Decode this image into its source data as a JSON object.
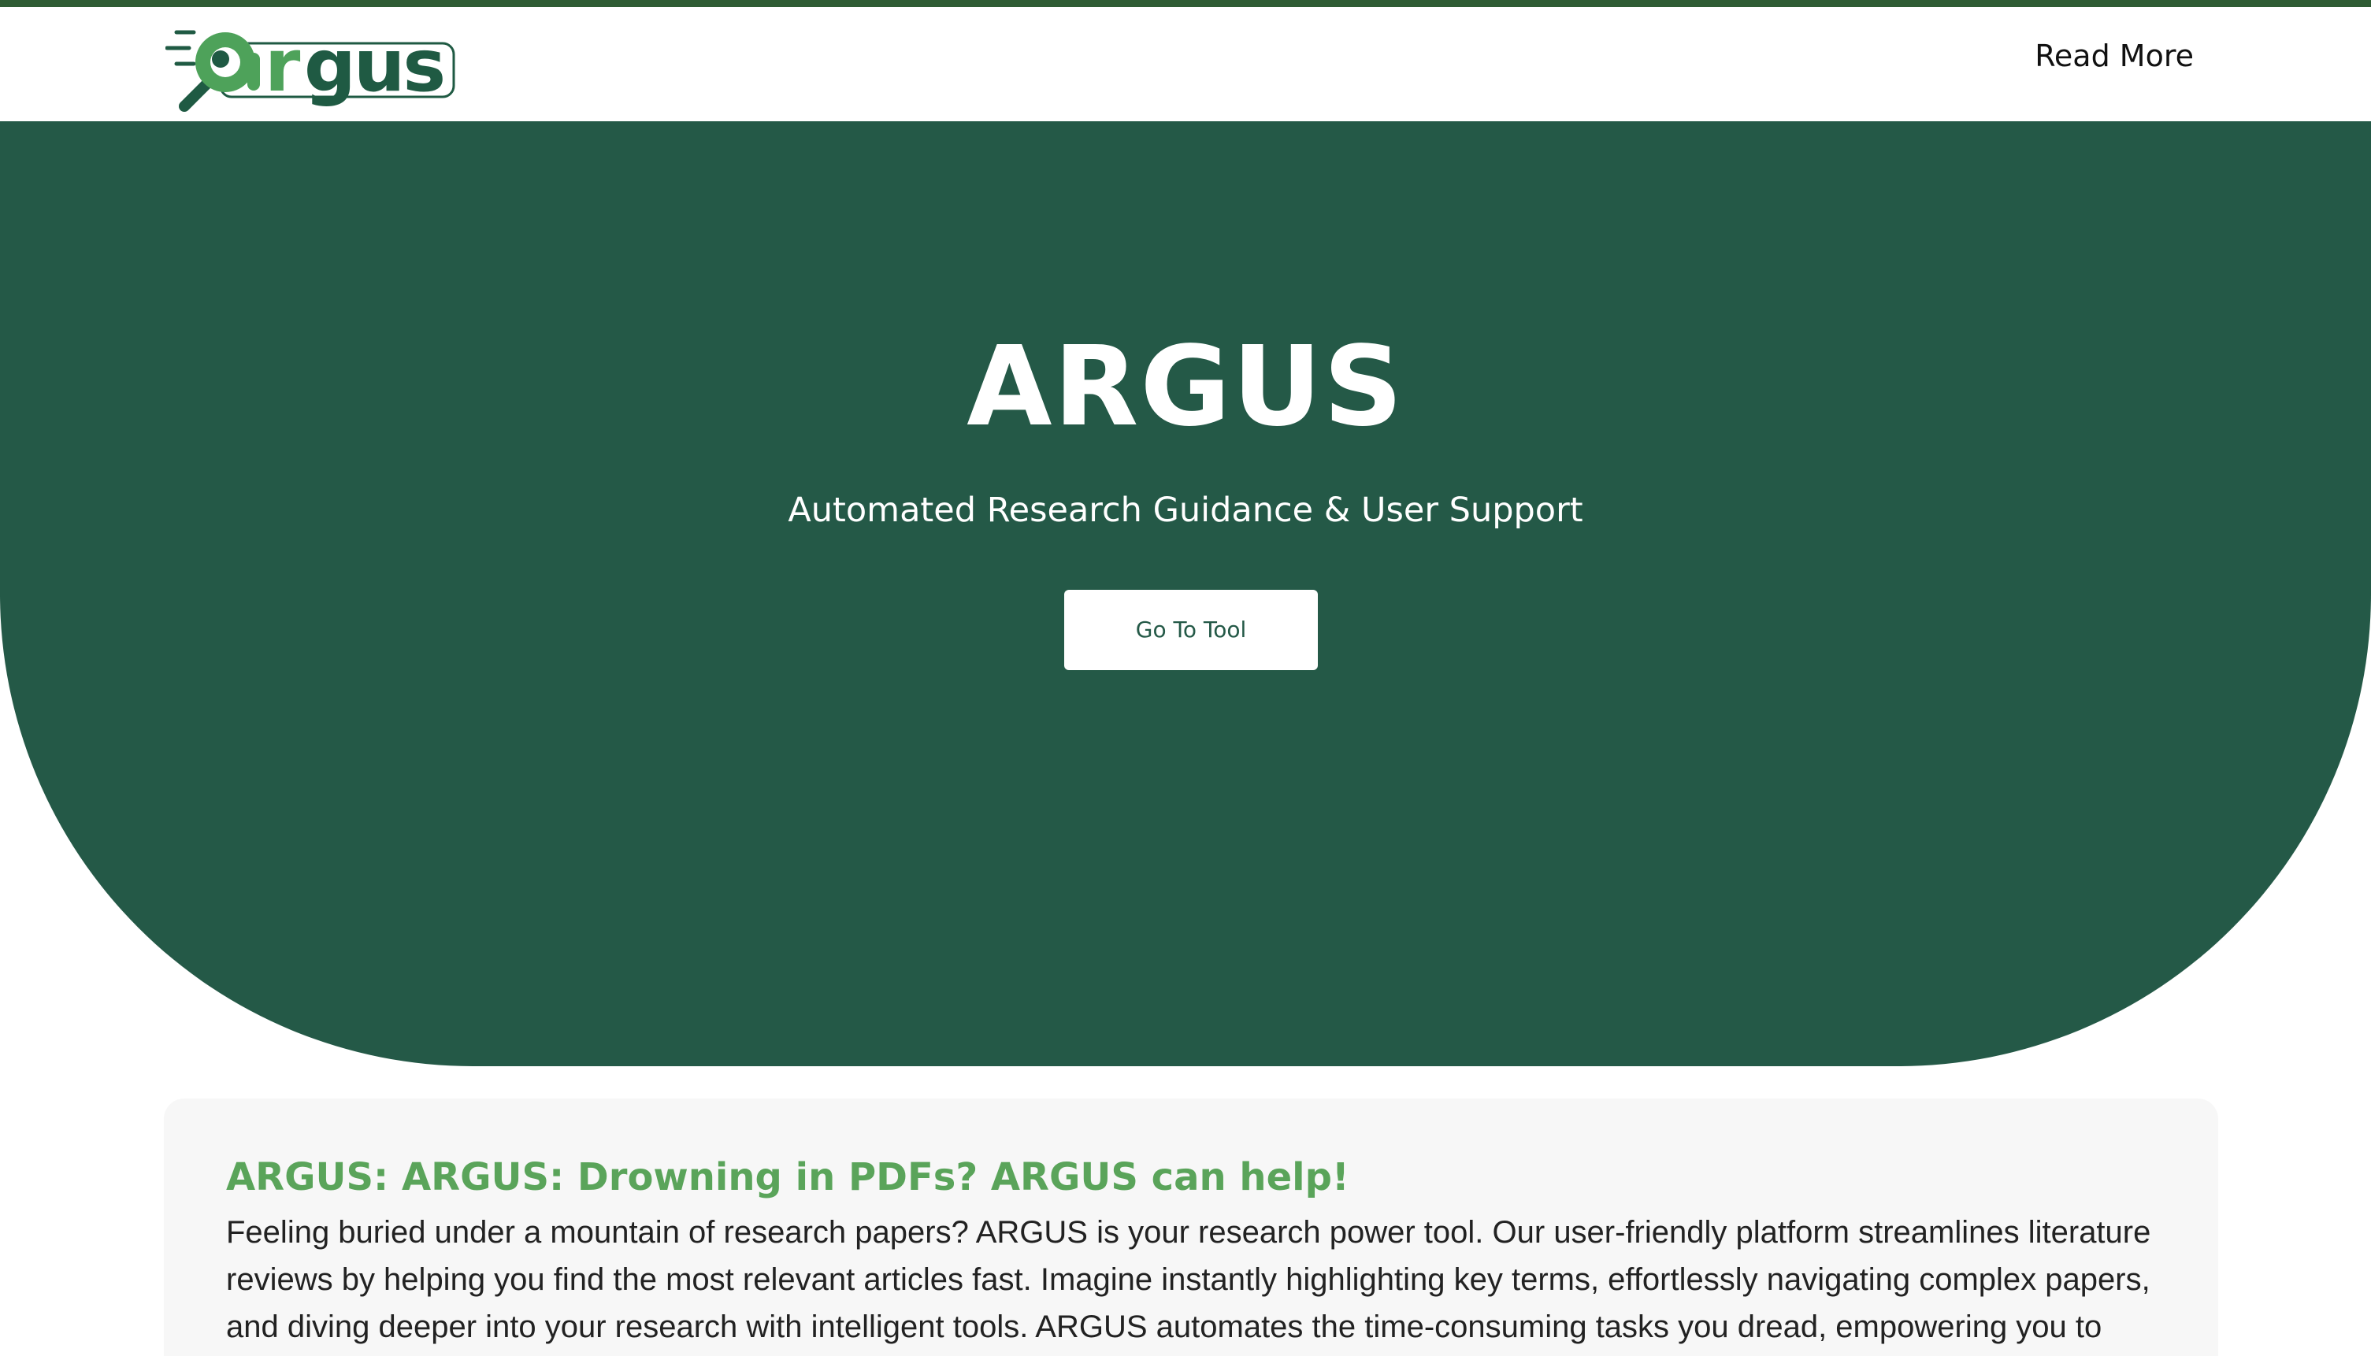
{
  "colors": {
    "top_strip": "#2f5c34",
    "hero_background": "#245947",
    "logo_light_green": "#4ea25a",
    "logo_dark_green": "#1f5a43",
    "card_background": "#f7f7f7",
    "card_title": "#5aa45a",
    "body_text": "#222222"
  },
  "navbar": {
    "logo_text": "argus",
    "logo_icon": "magnifier-icon",
    "read_more": "Read More"
  },
  "hero": {
    "title": "ARGUS",
    "subtitle": "Automated Research Guidance & User Support",
    "button": "Go To Tool"
  },
  "intro_card": {
    "title": "ARGUS: ARGUS: Drowning in PDFs? ARGUS can help!",
    "body": "Feeling buried under a mountain of research papers? ARGUS is your research power tool. Our user-friendly platform streamlines literature reviews by helping you find the most relevant articles fast. Imagine instantly highlighting key terms, effortlessly navigating complex papers, and diving deeper into your research with intelligent tools. ARGUS automates the time-consuming tasks you dread, empowering you to"
  }
}
